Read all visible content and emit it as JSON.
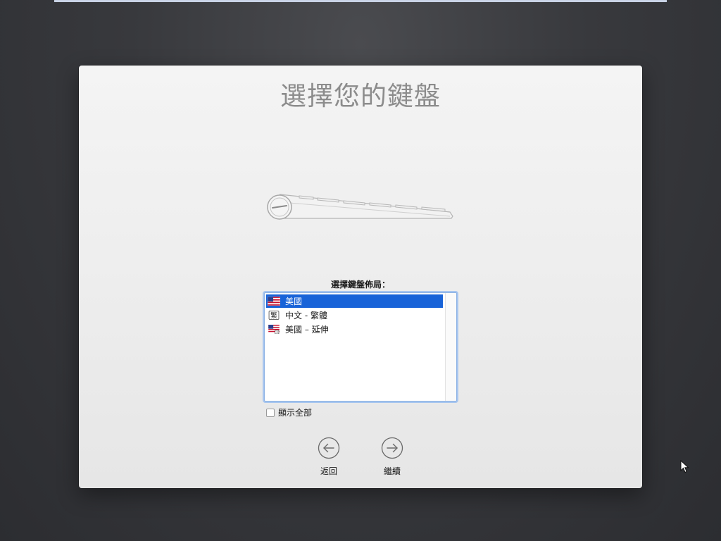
{
  "setup": {
    "title": "選擇您的鍵盤",
    "layout_label": "選擇鍵盤佈局："
  },
  "layouts": {
    "items": [
      {
        "label": "美國",
        "icon": "us-flag-icon",
        "selected": true
      },
      {
        "label": "中文 - 繁體",
        "icon": "traditional-chinese-icon",
        "selected": false
      },
      {
        "label": "美國 – 延伸",
        "icon": "us-extended-flag-icon",
        "selected": false
      }
    ],
    "traditional_glyph": "繁"
  },
  "show_all": {
    "label": "顯示全部",
    "checked": false
  },
  "nav": {
    "back_label": "返回",
    "continue_label": "繼續"
  },
  "colors": {
    "selection": "#1863d8",
    "list_focus_ring": "#a8c6ef",
    "title": "#8c8c8c"
  }
}
